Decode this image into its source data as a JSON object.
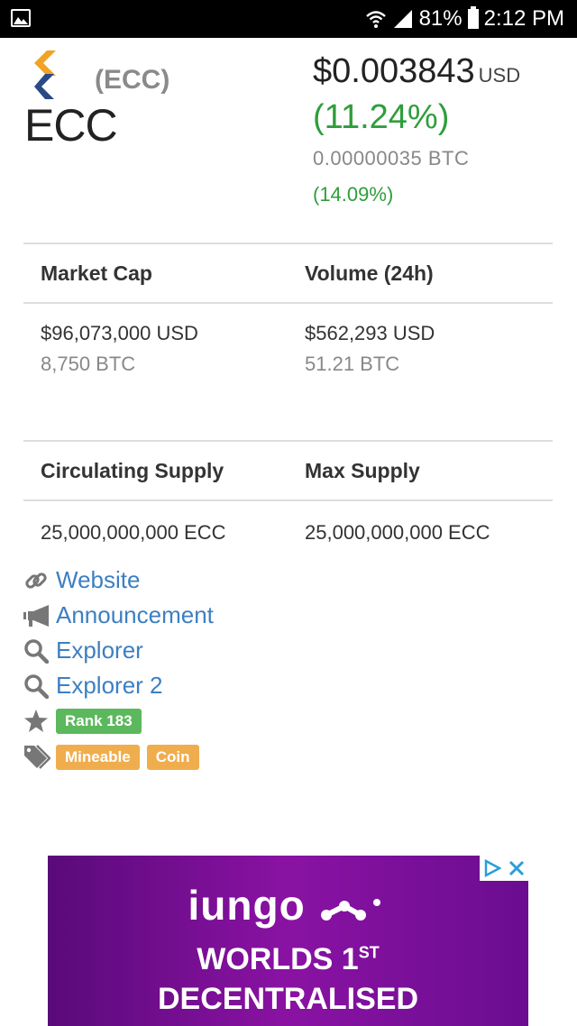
{
  "status_bar": {
    "battery": "81%",
    "time": "2:12 PM"
  },
  "coin": {
    "symbol_paren": "(ECC)",
    "name": "ECC",
    "price_usd": "$0.003843",
    "price_currency": "USD",
    "change_usd": "(11.24%)",
    "price_btc": "0.00000035 BTC",
    "change_btc": "(14.09%)"
  },
  "stats": {
    "market_cap": {
      "label": "Market Cap",
      "usd": "$96,073,000 USD",
      "btc": "8,750 BTC"
    },
    "volume": {
      "label": "Volume (24h)",
      "usd": "$562,293 USD",
      "btc": "51.21 BTC"
    },
    "circulating_supply": {
      "label": "Circulating Supply",
      "value": "25,000,000,000 ECC"
    },
    "max_supply": {
      "label": "Max Supply",
      "value": "25,000,000,000 ECC"
    }
  },
  "links": [
    {
      "icon": "link-icon",
      "label": "Website"
    },
    {
      "icon": "bullhorn-icon",
      "label": "Announcement"
    },
    {
      "icon": "search-icon",
      "label": "Explorer"
    },
    {
      "icon": "search-icon",
      "label": "Explorer 2"
    }
  ],
  "rank": {
    "icon": "star-icon",
    "label": "Rank 183"
  },
  "tags": {
    "icon": "tags-icon",
    "items": [
      "Mineable",
      "Coin"
    ]
  },
  "ad": {
    "brand": "iungo",
    "line1": "WORLDS 1",
    "line1_sup": "ST",
    "line2": "DECENTRALISED"
  },
  "colors": {
    "positive": "#2e9e3b",
    "link": "#3d7fc1",
    "rank_badge": "#5cb85c",
    "tag_badge": "#f0ad4e",
    "ad_background": "#6a0d8f"
  }
}
